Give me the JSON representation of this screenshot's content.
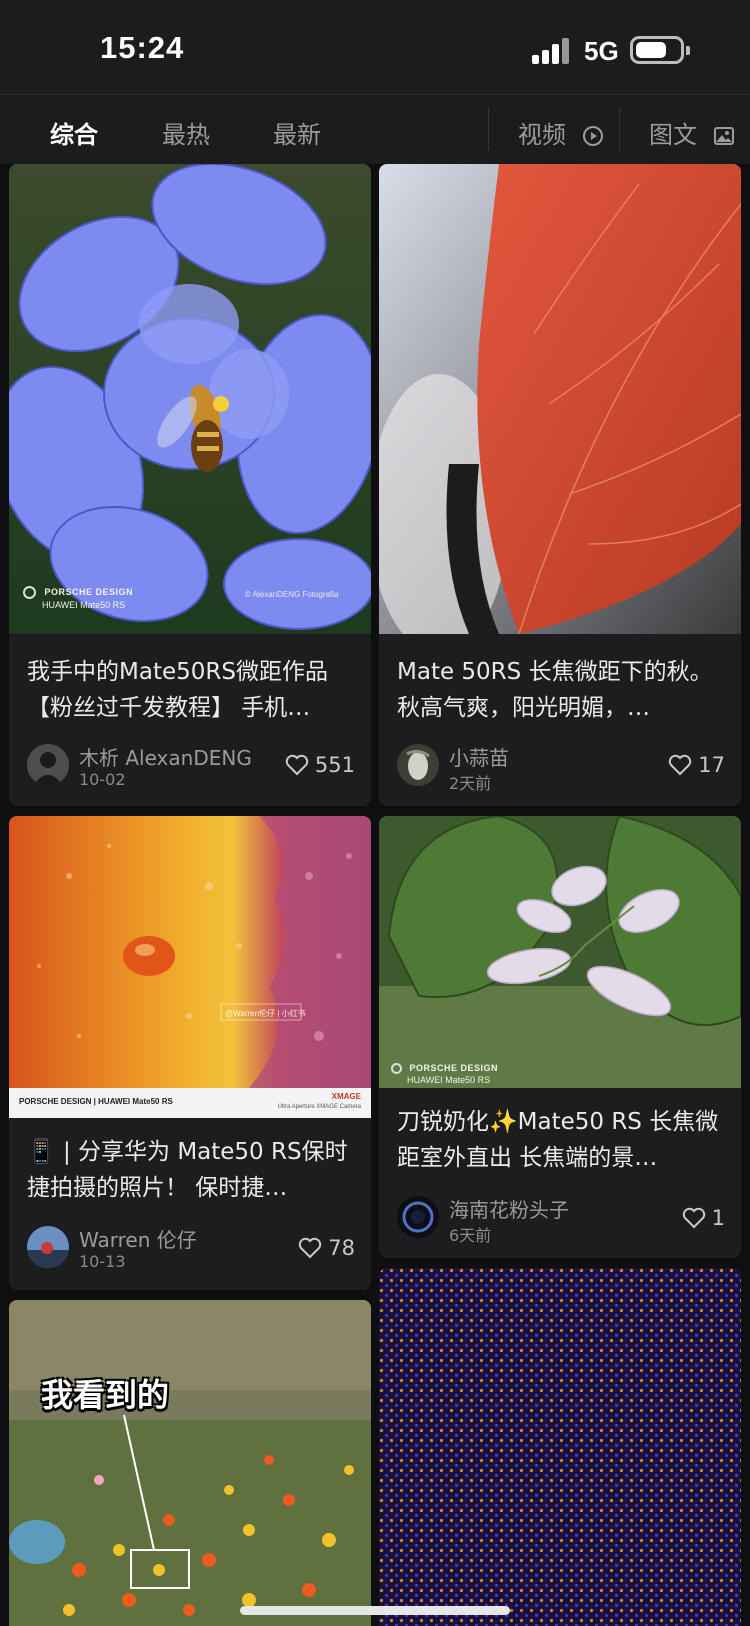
{
  "status_bar": {
    "time": "15:24",
    "network": "5G"
  },
  "tabs": [
    {
      "label": "综合",
      "active": true
    },
    {
      "label": "最热",
      "active": false
    },
    {
      "label": "最新",
      "active": false
    },
    {
      "label": "视频",
      "icon": "play-icon"
    },
    {
      "label": "图文",
      "icon": "image-icon"
    }
  ],
  "cards": [
    {
      "title": "我手中的Mate50RS微距作品【粉丝过千发教程】 手机…",
      "author": "木析 AlexanDENG",
      "date": "10-02",
      "likes": "551",
      "watermark_brand": "PORSCHE DESIGN",
      "watermark_model": "HUAWEI Mate50 RS",
      "watermark_credit": "© AlexanDENG Fotografia"
    },
    {
      "title": "Mate 50RS 长焦微距下的秋。 秋高气爽，阳光明媚，…",
      "author": "小蒜苗",
      "date": "2天前",
      "likes": "17"
    },
    {
      "title": "📱 | 分享华为 Mate50 RS保时捷拍摄的照片！ 保时捷…",
      "author": "Warren 伦仔",
      "date": "10-13",
      "likes": "78",
      "footer_left": "PORSCHE DESIGN | HUAWEI Mate50 RS",
      "footer_right_top": "XMAGE",
      "footer_right_bottom": "Ultra Aperture XMAGE Camera",
      "overlay_tag": "@Warren伦仔 | 小红书"
    },
    {
      "title": "刀锐奶化✨Mate50 RS 长焦微距室外直出 长焦端的景…",
      "author": "海南花粉头子",
      "date": "6天前",
      "likes": "1",
      "watermark_brand": "PORSCHE DESIGN",
      "watermark_model": "HUAWEI Mate50 RS"
    },
    {
      "overlay_text": "我看到的"
    },
    {}
  ],
  "colors": {
    "background": "#0f0f11",
    "card": "#1d1d20",
    "text": "#eaeaea",
    "muted": "#9b9b9f"
  }
}
